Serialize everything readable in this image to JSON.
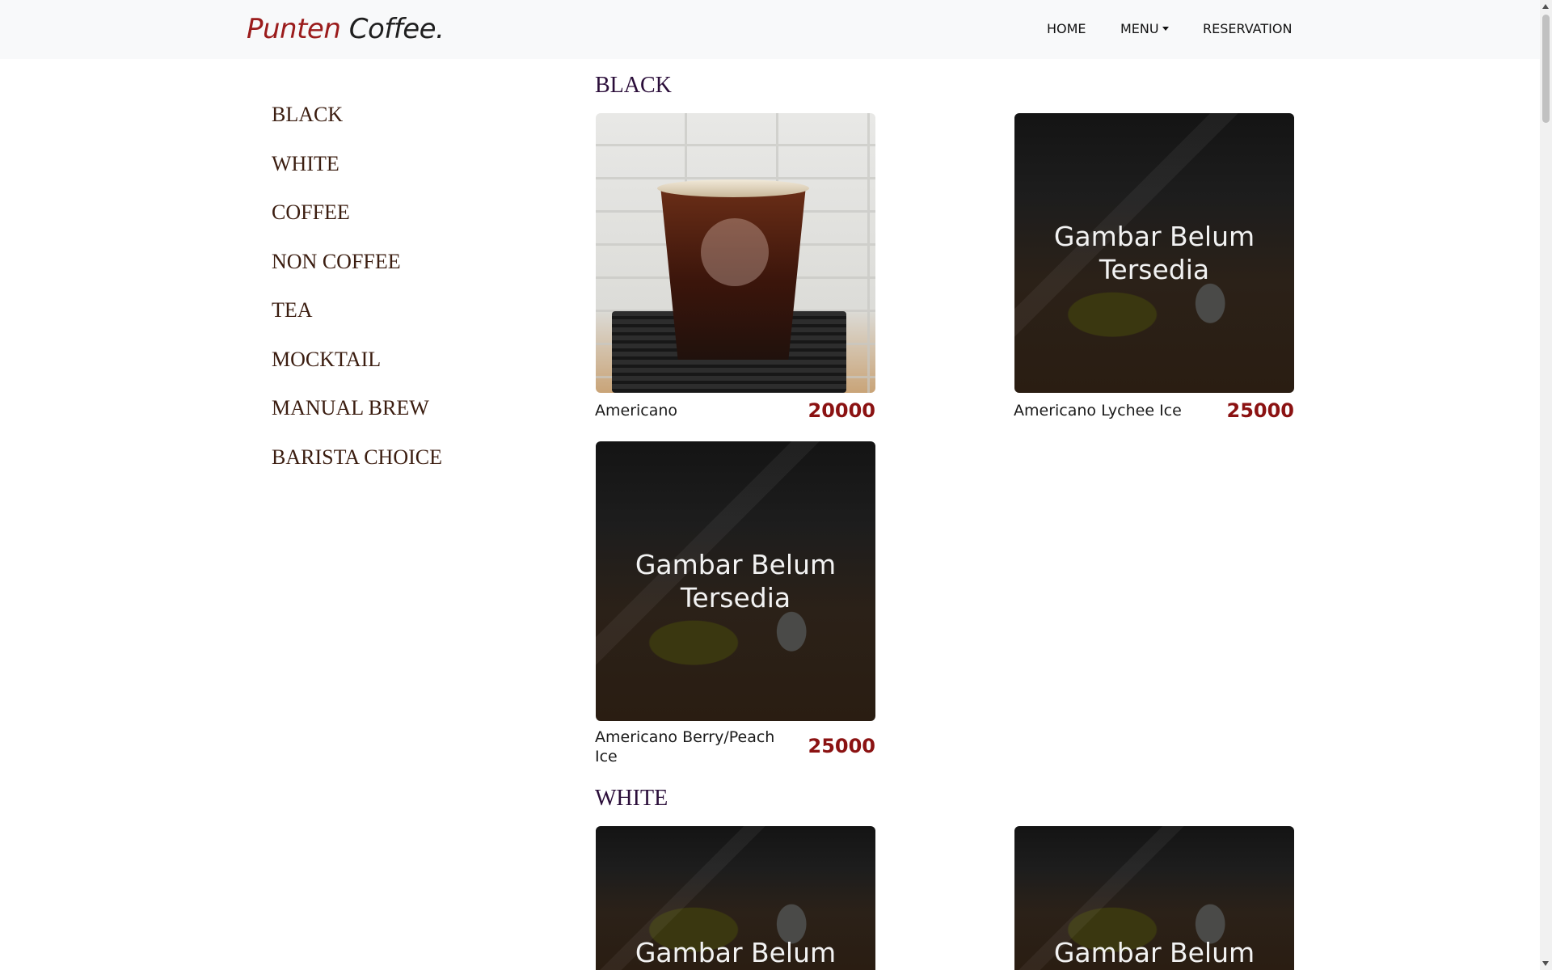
{
  "brand": {
    "first": "Punten",
    "second": "Coffee."
  },
  "nav": {
    "home": "HOME",
    "menu": "MENU",
    "reservation": "RESERVATION"
  },
  "sidebar": {
    "items": [
      "BLACK",
      "WHITE",
      "COFFEE",
      "NON COFFEE",
      "TEA",
      "MOCKTAIL",
      "MANUAL BREW",
      "BARISTA CHOICE"
    ]
  },
  "sections": [
    {
      "title": "BLACK",
      "items": [
        {
          "name": "Americano",
          "price": "20000",
          "image": "photo"
        },
        {
          "name": "Americano Lychee Ice",
          "price": "25000",
          "image": "placeholder"
        },
        {
          "name": "Americano Berry/Peach Ice",
          "price": "25000",
          "image": "placeholder"
        }
      ]
    },
    {
      "title": "WHITE",
      "items": [
        {
          "image": "placeholder"
        },
        {
          "image": "placeholder"
        }
      ]
    }
  ],
  "placeholder_text": "Gambar Belum Tersedia",
  "colors": {
    "brand_accent": "#9b1c1c",
    "price": "#8b1212",
    "section_title": "#2b0e3a",
    "sidebar_text": "#3b1d10"
  }
}
